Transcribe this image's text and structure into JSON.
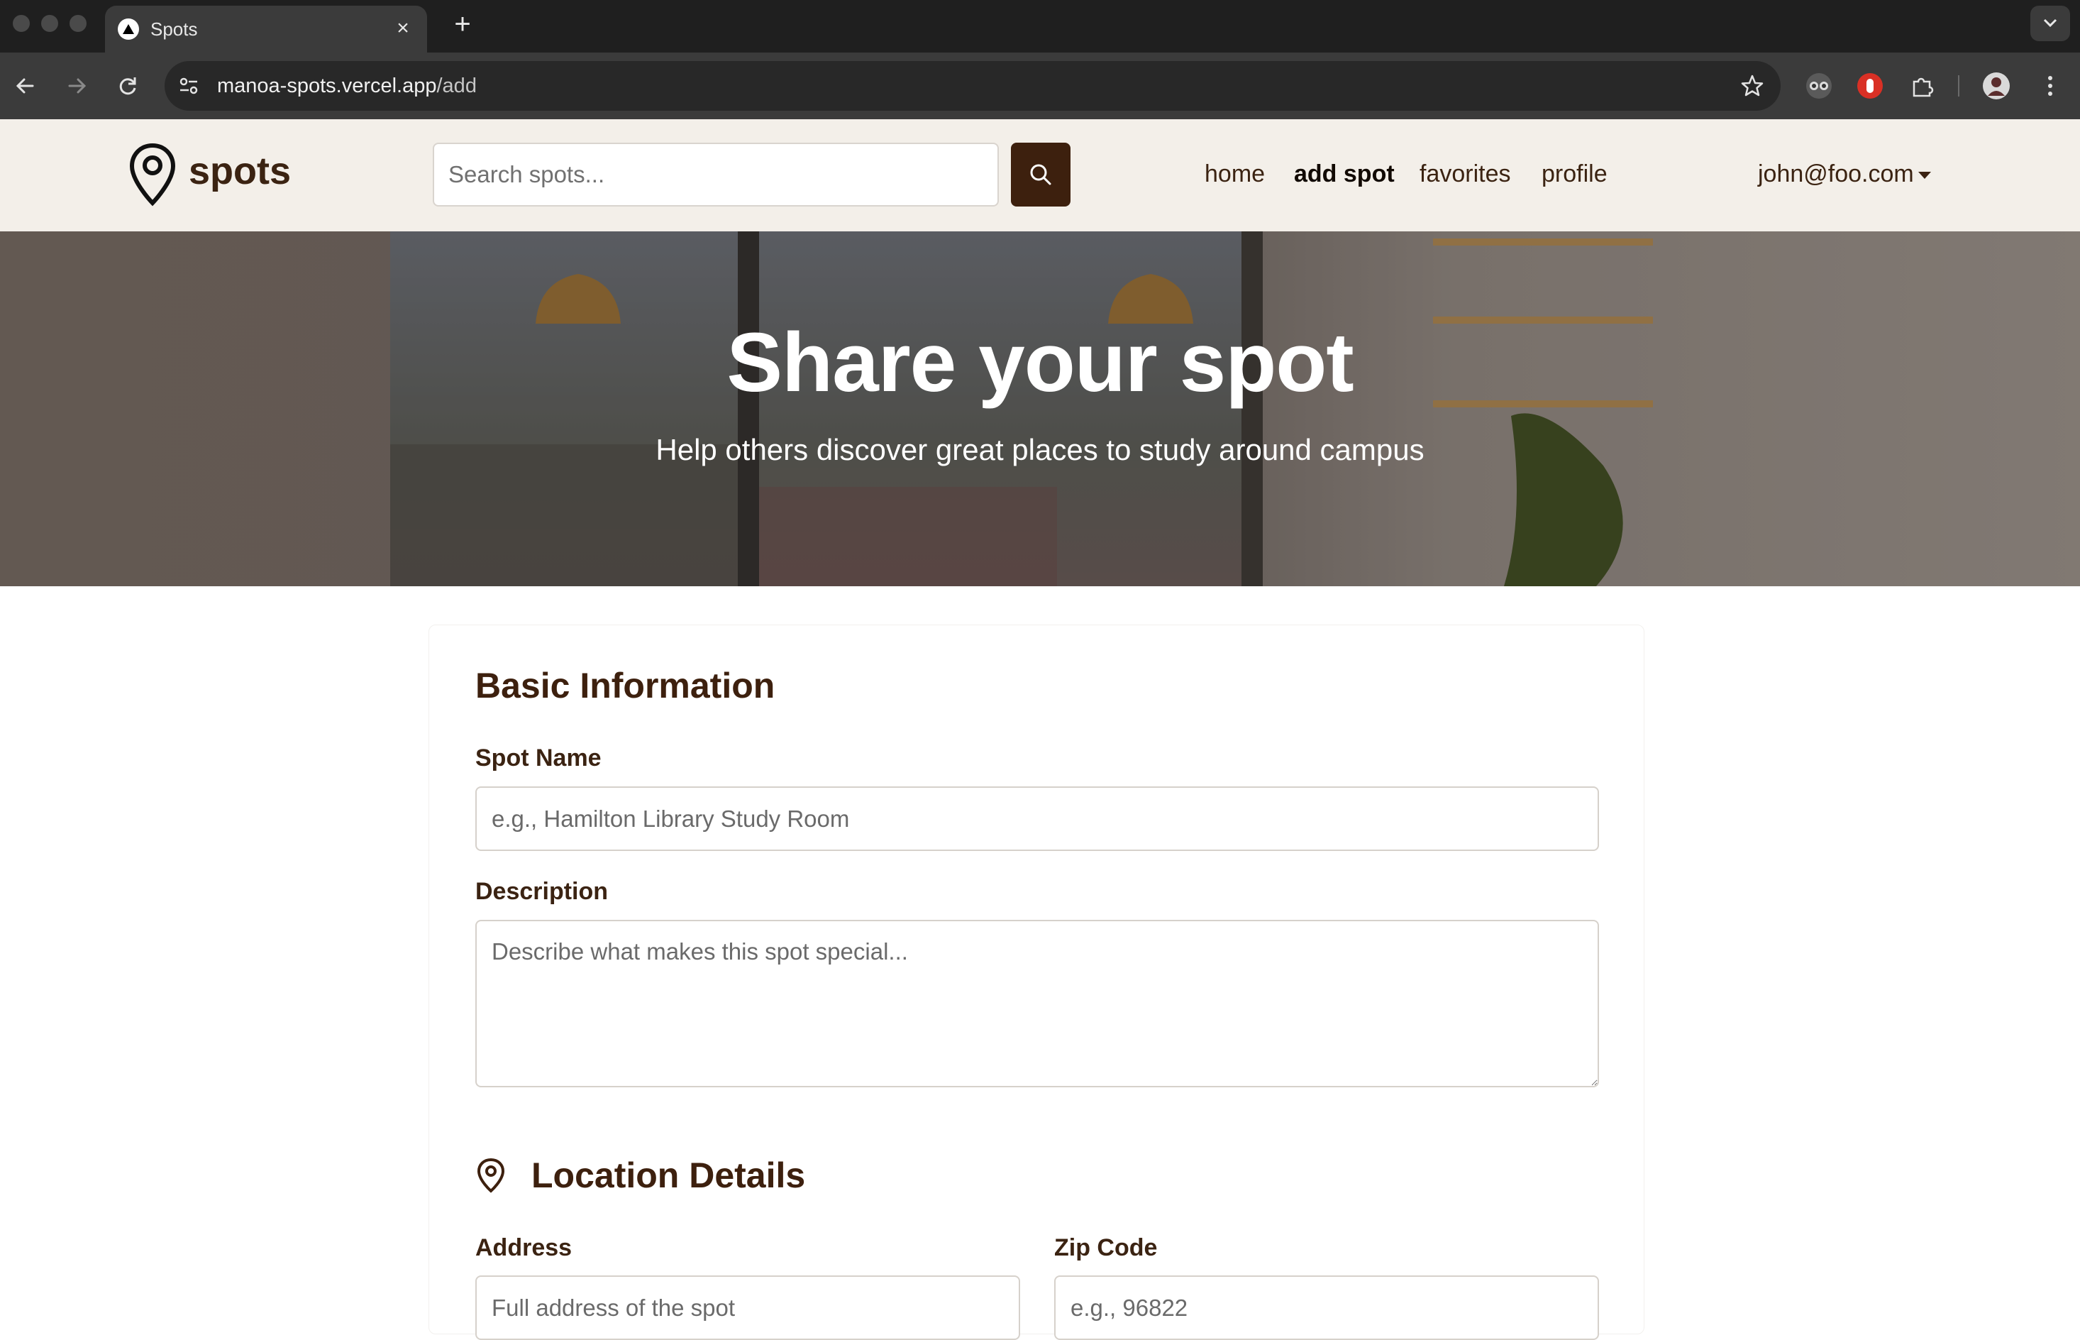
{
  "browser": {
    "tab_title": "Spots",
    "tab_close": "×",
    "new_tab": "+",
    "url_host": "manoa-spots.vercel.app",
    "url_path": "/add"
  },
  "navbar": {
    "logo_text": "spots",
    "search_placeholder": "Search spots...",
    "links": [
      "home",
      "add spot",
      "favorites",
      "profile"
    ],
    "active_link": "add spot",
    "user_email": "john@foo.com"
  },
  "hero": {
    "title": "Share your spot",
    "subtitle": "Help others discover great places to study around campus"
  },
  "form": {
    "basic_title": "Basic Information",
    "spot_name_label": "Spot Name",
    "spot_name_placeholder": "e.g., Hamilton Library Study Room",
    "description_label": "Description",
    "description_placeholder": "Describe what makes this spot special...",
    "location_title": "Location Details",
    "address_label": "Address",
    "address_placeholder": "Full address of the spot",
    "zip_label": "Zip Code",
    "zip_placeholder": "e.g., 96822"
  },
  "colors": {
    "brand_dark": "#3d200e",
    "nav_bg": "#f3efe9",
    "text_brown": "#3b2312"
  }
}
